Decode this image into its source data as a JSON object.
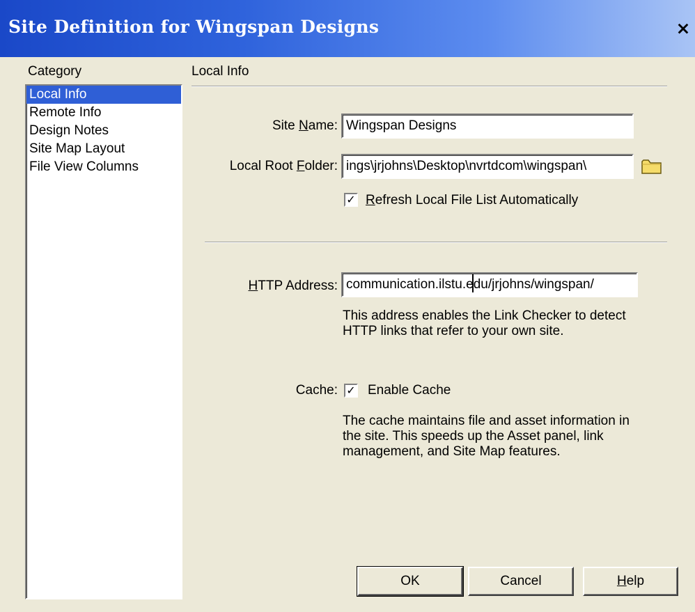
{
  "window": {
    "title": "Site Definition for Wingspan Designs",
    "close_glyph": "×"
  },
  "category": {
    "heading": "Category",
    "items": [
      {
        "label": "Local Info",
        "selected": true
      },
      {
        "label": "Remote Info",
        "selected": false
      },
      {
        "label": "Design Notes",
        "selected": false
      },
      {
        "label": "Site Map Layout",
        "selected": false
      },
      {
        "label": "File View Columns",
        "selected": false
      }
    ]
  },
  "section": {
    "heading": "Local Info"
  },
  "site_name": {
    "label_pre": "Site ",
    "label_ul": "N",
    "label_post": "ame:",
    "value": "Wingspan Designs"
  },
  "local_root": {
    "label_pre": "Local Root ",
    "label_ul": "F",
    "label_post": "older:",
    "value": "ings\\jrjohns\\Desktop\\nvrtdcom\\wingspan\\",
    "folder_icon": "folder-icon"
  },
  "refresh": {
    "checked": true,
    "label_ul": "R",
    "label_post": "efresh Local File List Automatically"
  },
  "http": {
    "label_ul": "H",
    "label_post": "TTP Address:",
    "value": "communication.ilstu.edu/jrjohns/wingspan/",
    "note": "This address enables the Link Checker to detect HTTP links that refer to your own site."
  },
  "cache": {
    "label": "Cache:",
    "checked": true,
    "checkbox_label": "Enable Cache",
    "note": "The cache maintains file and asset information in the site.  This speeds up the Asset panel, link management, and Site Map features."
  },
  "buttons": {
    "ok": "OK",
    "cancel": "Cancel",
    "help_ul": "H",
    "help_post": "elp"
  },
  "colors": {
    "titlebar_start": "#1a48c8",
    "titlebar_end": "#a9c4f5",
    "selection": "#2f5fd6",
    "dialog_bg": "#ece9d8",
    "folder_fill": "#f5dc6a"
  }
}
